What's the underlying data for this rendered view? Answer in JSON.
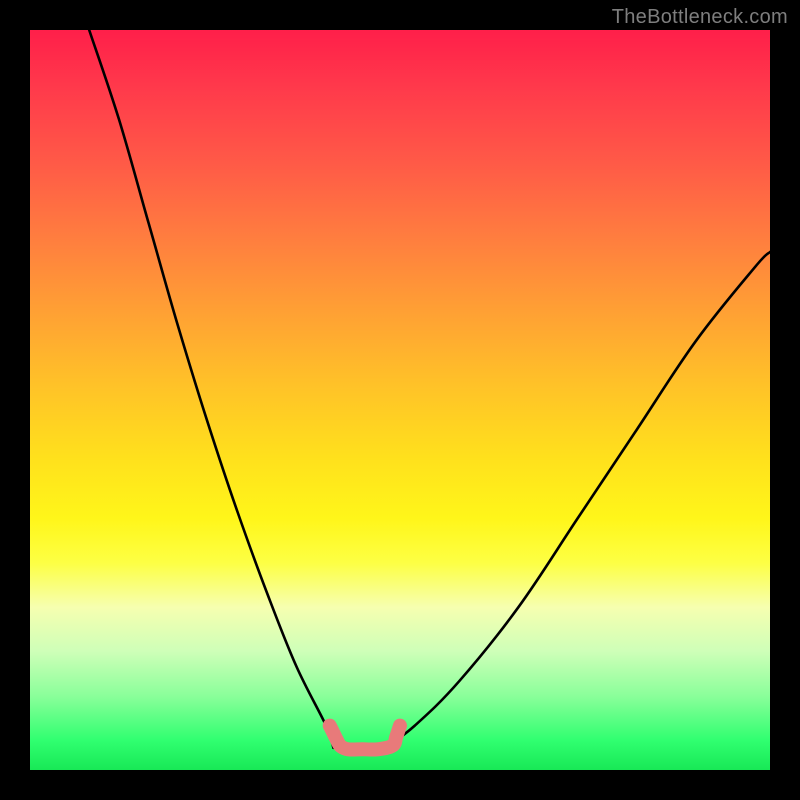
{
  "watermark": "TheBottleneck.com",
  "chart_data": {
    "type": "line",
    "title": "",
    "xlabel": "",
    "ylabel": "",
    "xlim": [
      0,
      100
    ],
    "ylim": [
      0,
      100
    ],
    "grid": false,
    "legend": false,
    "series": [
      {
        "name": "left-branch",
        "stroke": "#000000",
        "x": [
          8,
          12,
          16,
          20,
          24,
          28,
          32,
          36,
          40,
          41
        ],
        "y": [
          100,
          88,
          74,
          60,
          47,
          35,
          24,
          14,
          6,
          3
        ]
      },
      {
        "name": "right-branch",
        "stroke": "#000000",
        "x": [
          48,
          52,
          58,
          66,
          74,
          82,
          90,
          98,
          100
        ],
        "y": [
          3,
          6,
          12,
          22,
          34,
          46,
          58,
          68,
          70
        ]
      },
      {
        "name": "valley-marker",
        "stroke": "#e87a7a",
        "x": [
          40.5,
          41,
          41.5,
          42,
          43,
          45,
          47,
          49,
          49.5,
          50
        ],
        "y": [
          6,
          5,
          4,
          3.2,
          2.8,
          2.8,
          2.8,
          3.3,
          4.5,
          6
        ]
      }
    ],
    "annotations": []
  },
  "colors": {
    "frame": "#000000",
    "gradient_top": "#ff1f4a",
    "gradient_mid": "#ffe11c",
    "gradient_bottom": "#18e856",
    "curve_stroke": "#000000",
    "valley_stroke": "#e87a7a",
    "watermark": "#7e7e7e"
  }
}
